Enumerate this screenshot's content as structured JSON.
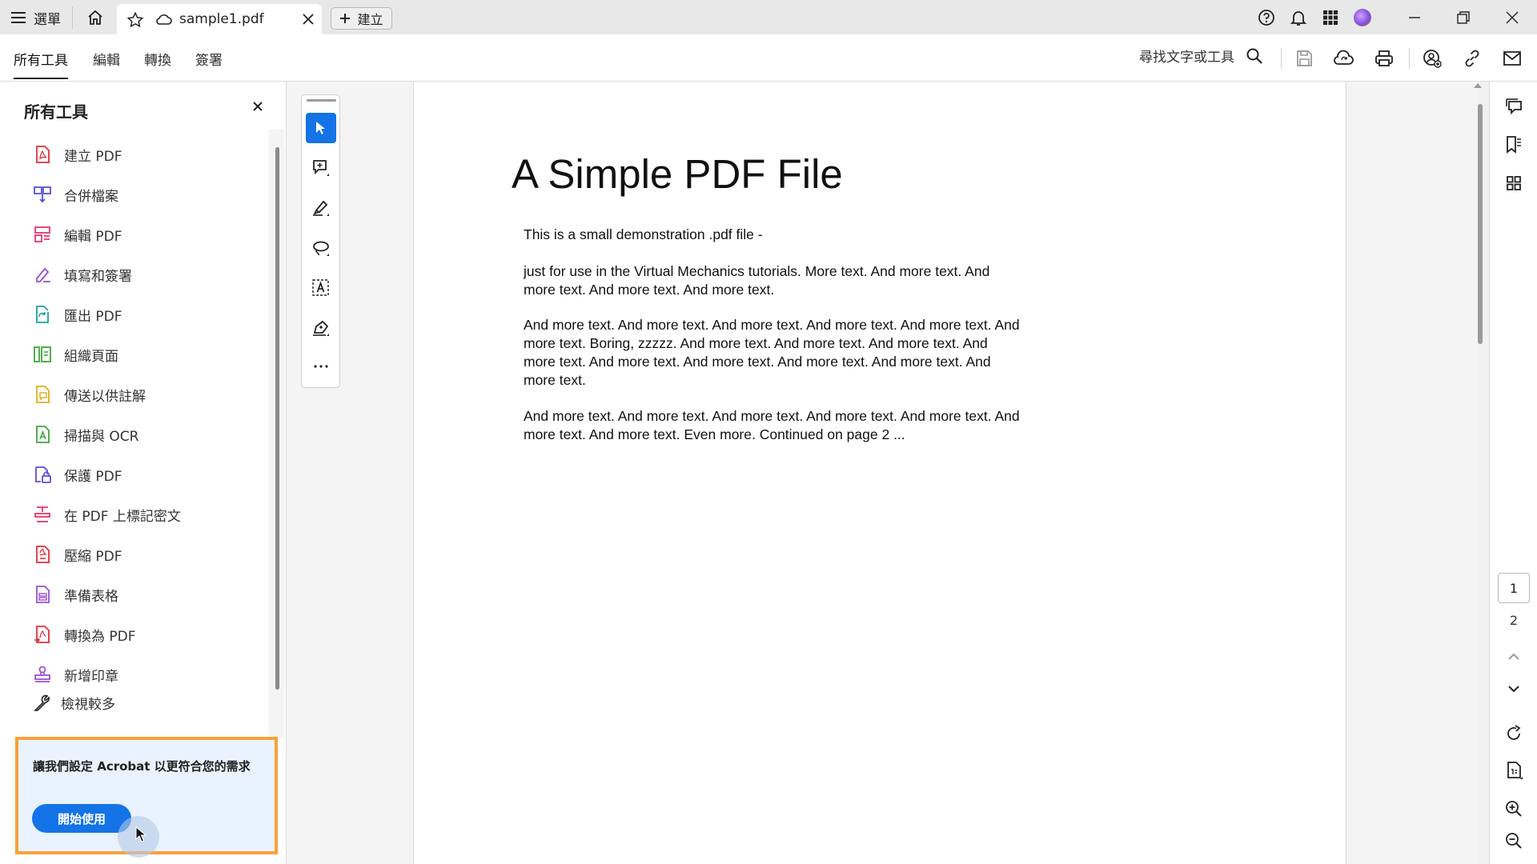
{
  "titlebar": {
    "menu_label": "選單",
    "tab_title": "sample1.pdf",
    "create_label": "建立"
  },
  "toolbar": {
    "tabs": [
      "所有工具",
      "編輯",
      "轉換",
      "簽署"
    ],
    "search_label": "尋找文字或工具"
  },
  "panel": {
    "title": "所有工具",
    "items": [
      {
        "label": "建立 PDF",
        "icon": "create-pdf-icon",
        "color": "#e0303c"
      },
      {
        "label": "合併檔案",
        "icon": "combine-files-icon",
        "color": "#5a4fd6"
      },
      {
        "label": "編輯 PDF",
        "icon": "edit-pdf-icon",
        "color": "#e8366a"
      },
      {
        "label": "填寫和簽署",
        "icon": "fill-sign-icon",
        "color": "#9a4fd6"
      },
      {
        "label": "匯出 PDF",
        "icon": "export-pdf-icon",
        "color": "#1ba39c"
      },
      {
        "label": "組織頁面",
        "icon": "organize-pages-icon",
        "color": "#3fa63a"
      },
      {
        "label": "傳送以供註解",
        "icon": "send-comment-icon",
        "color": "#e0b020"
      },
      {
        "label": "掃描與 OCR",
        "icon": "scan-ocr-icon",
        "color": "#3fa63a"
      },
      {
        "label": "保護 PDF",
        "icon": "protect-pdf-icon",
        "color": "#5a4fd6"
      },
      {
        "label": "在 PDF 上標記密文",
        "icon": "redact-icon",
        "color": "#e8366a"
      },
      {
        "label": "壓縮 PDF",
        "icon": "compress-pdf-icon",
        "color": "#e0303c"
      },
      {
        "label": "準備表格",
        "icon": "prepare-form-icon",
        "color": "#9a4fd6"
      },
      {
        "label": "轉換為 PDF",
        "icon": "convert-pdf-icon",
        "color": "#e0303c"
      },
      {
        "label": "新增印章",
        "icon": "stamp-icon",
        "color": "#9a4fd6"
      }
    ],
    "view_more": "檢視較多",
    "promo_text": "讓我們設定  Acrobat 以更符合您的需求",
    "promo_button": "開始使用"
  },
  "document": {
    "title": "A Simple PDF File",
    "paragraphs": [
      "This is a small demonstration .pdf file -",
      "just for use in the Virtual Mechanics tutorials. More text. And more text. And more text. And more text. And more text.",
      "And more text. And more text. And more text. And more text. And more text. And more text. Boring, zzzzz. And more text. And more text. And more text. And more text. And more text. And more text. And more text. And more text. And more text.",
      "And more text. And more text. And more text. And more text. And more text. And more text. And more text. Even more. Continued on page 2 ..."
    ]
  },
  "page_nav": {
    "pages": [
      "1",
      "2"
    ],
    "current": "1"
  },
  "colors": {
    "accent": "#1473e6",
    "promo_border": "#f7a23b",
    "promo_bg": "#e9f3ff"
  }
}
